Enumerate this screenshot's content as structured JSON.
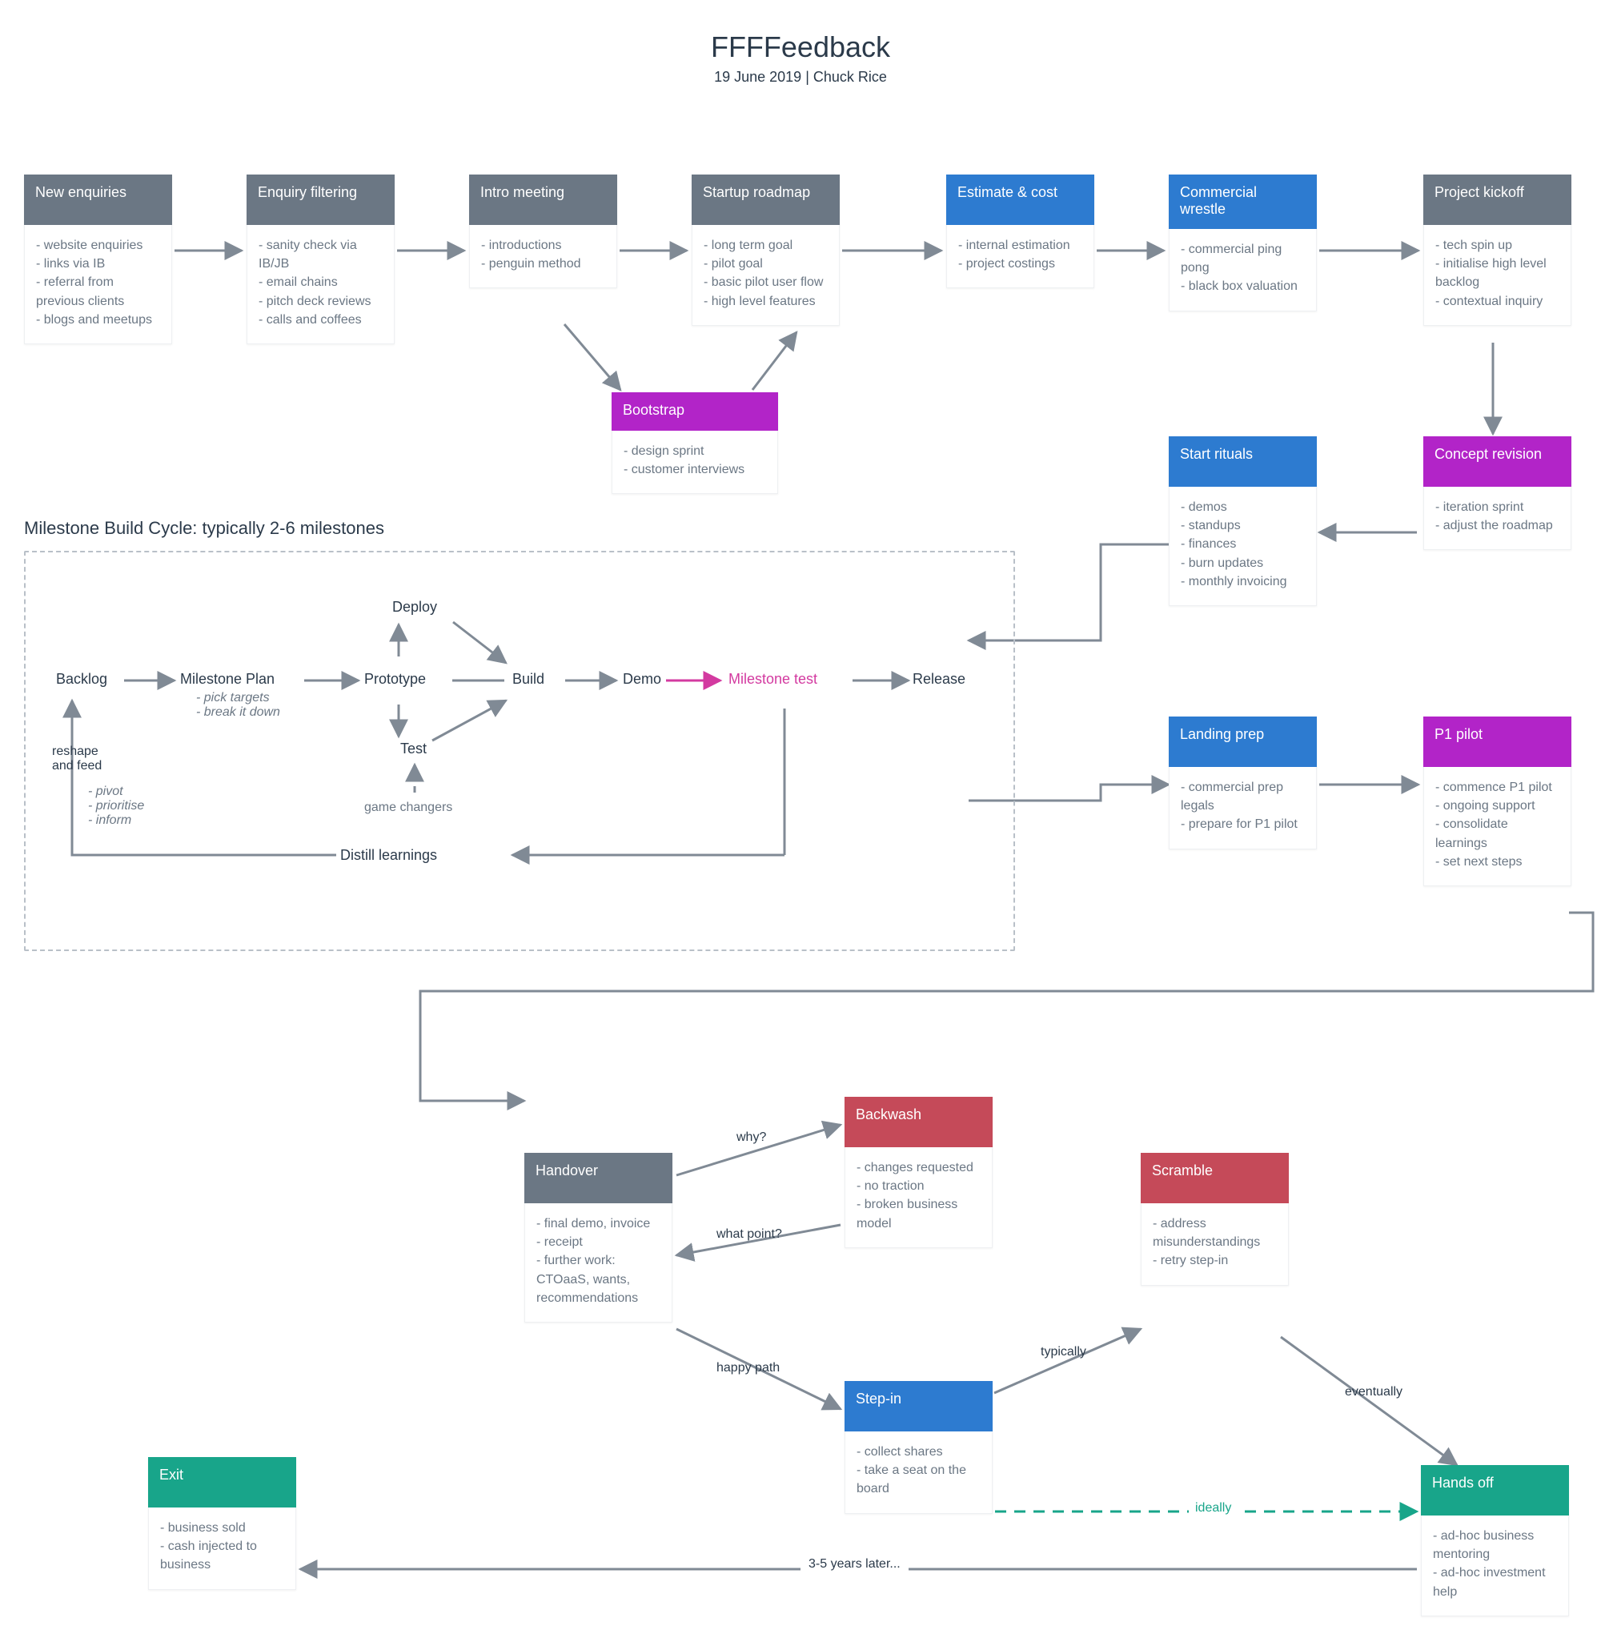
{
  "title": "FFFFeedback",
  "subtitle": "19 June 2019 | Chuck Rice",
  "section_label": "Milestone Build Cycle: typically 2-6 milestones",
  "nodes": {
    "new_enquiries": {
      "title": "New enquiries",
      "body": "- website enquiries\n- links via IB\n- referral from previous clients\n- blogs and meetups"
    },
    "enquiry_filtering": {
      "title": "Enquiry filtering",
      "body": "- sanity check via IB/JB\n- email chains\n- pitch deck reviews\n- calls and coffees"
    },
    "intro_meeting": {
      "title": "Intro meeting",
      "body": "- introductions\n- penguin method"
    },
    "startup_roadmap": {
      "title": "Startup roadmap",
      "body": "- long term goal\n- pilot goal\n- basic pilot user flow\n- high level features"
    },
    "estimate_cost": {
      "title": "Estimate & cost",
      "body": "- internal estimation\n- project costings"
    },
    "commercial_wrestle": {
      "title": "Commercial wrestle",
      "body": "- commercial ping pong\n- black box valuation"
    },
    "project_kickoff": {
      "title": "Project kickoff",
      "body": "- tech spin up\n- initialise high level backlog\n- contextual inquiry"
    },
    "bootstrap": {
      "title": "Bootstrap",
      "body": "- design sprint\n- customer interviews"
    },
    "start_rituals": {
      "title": "Start rituals",
      "body": "- demos\n- standups\n- finances\n- burn updates\n- monthly invoicing"
    },
    "concept_revision": {
      "title": "Concept revision",
      "body": "- iteration sprint\n- adjust the roadmap"
    },
    "landing_prep": {
      "title": "Landing prep",
      "body": "- commercial prep legals\n- prepare for P1 pilot"
    },
    "p1_pilot": {
      "title": "P1 pilot",
      "body": "- commence P1 pilot\n- ongoing support\n- consolidate learnings\n- set next steps"
    },
    "handover": {
      "title": "Handover",
      "body": "- final demo, invoice\n- receipt\n- further work: CTOaaS, wants, recommendations"
    },
    "backwash": {
      "title": "Backwash",
      "body": "- changes requested\n- no traction\n- broken business model"
    },
    "scramble": {
      "title": "Scramble",
      "body": "- address misunderstandings\n- retry step-in"
    },
    "step_in": {
      "title": "Step-in",
      "body": "- collect shares\n- take a seat on the board"
    },
    "hands_off": {
      "title": "Hands off",
      "body": "- ad-hoc business mentoring\n- ad-hoc investment help"
    },
    "exit": {
      "title": "Exit",
      "body": "- business sold\n- cash injected to business"
    }
  },
  "cycle": {
    "backlog": "Backlog",
    "milestone_plan": "Milestone Plan",
    "milestone_plan_sub": "- pick targets\n- break it down",
    "prototype": "Prototype",
    "deploy": "Deploy",
    "test": "Test",
    "build": "Build",
    "demo": "Demo",
    "milestone_test": "Milestone test",
    "release": "Release",
    "distill": "Distill learnings",
    "game_changers": "game changers",
    "reshape": "reshape\nand feed",
    "reshape_sub": "- pivot\n- prioritise\n- inform"
  },
  "edge_labels": {
    "why": "why?",
    "what_point": "what point?",
    "happy_path": "happy path",
    "typically": "typically",
    "eventually": "eventually",
    "ideally": "ideally",
    "years": "3-5 years later..."
  }
}
